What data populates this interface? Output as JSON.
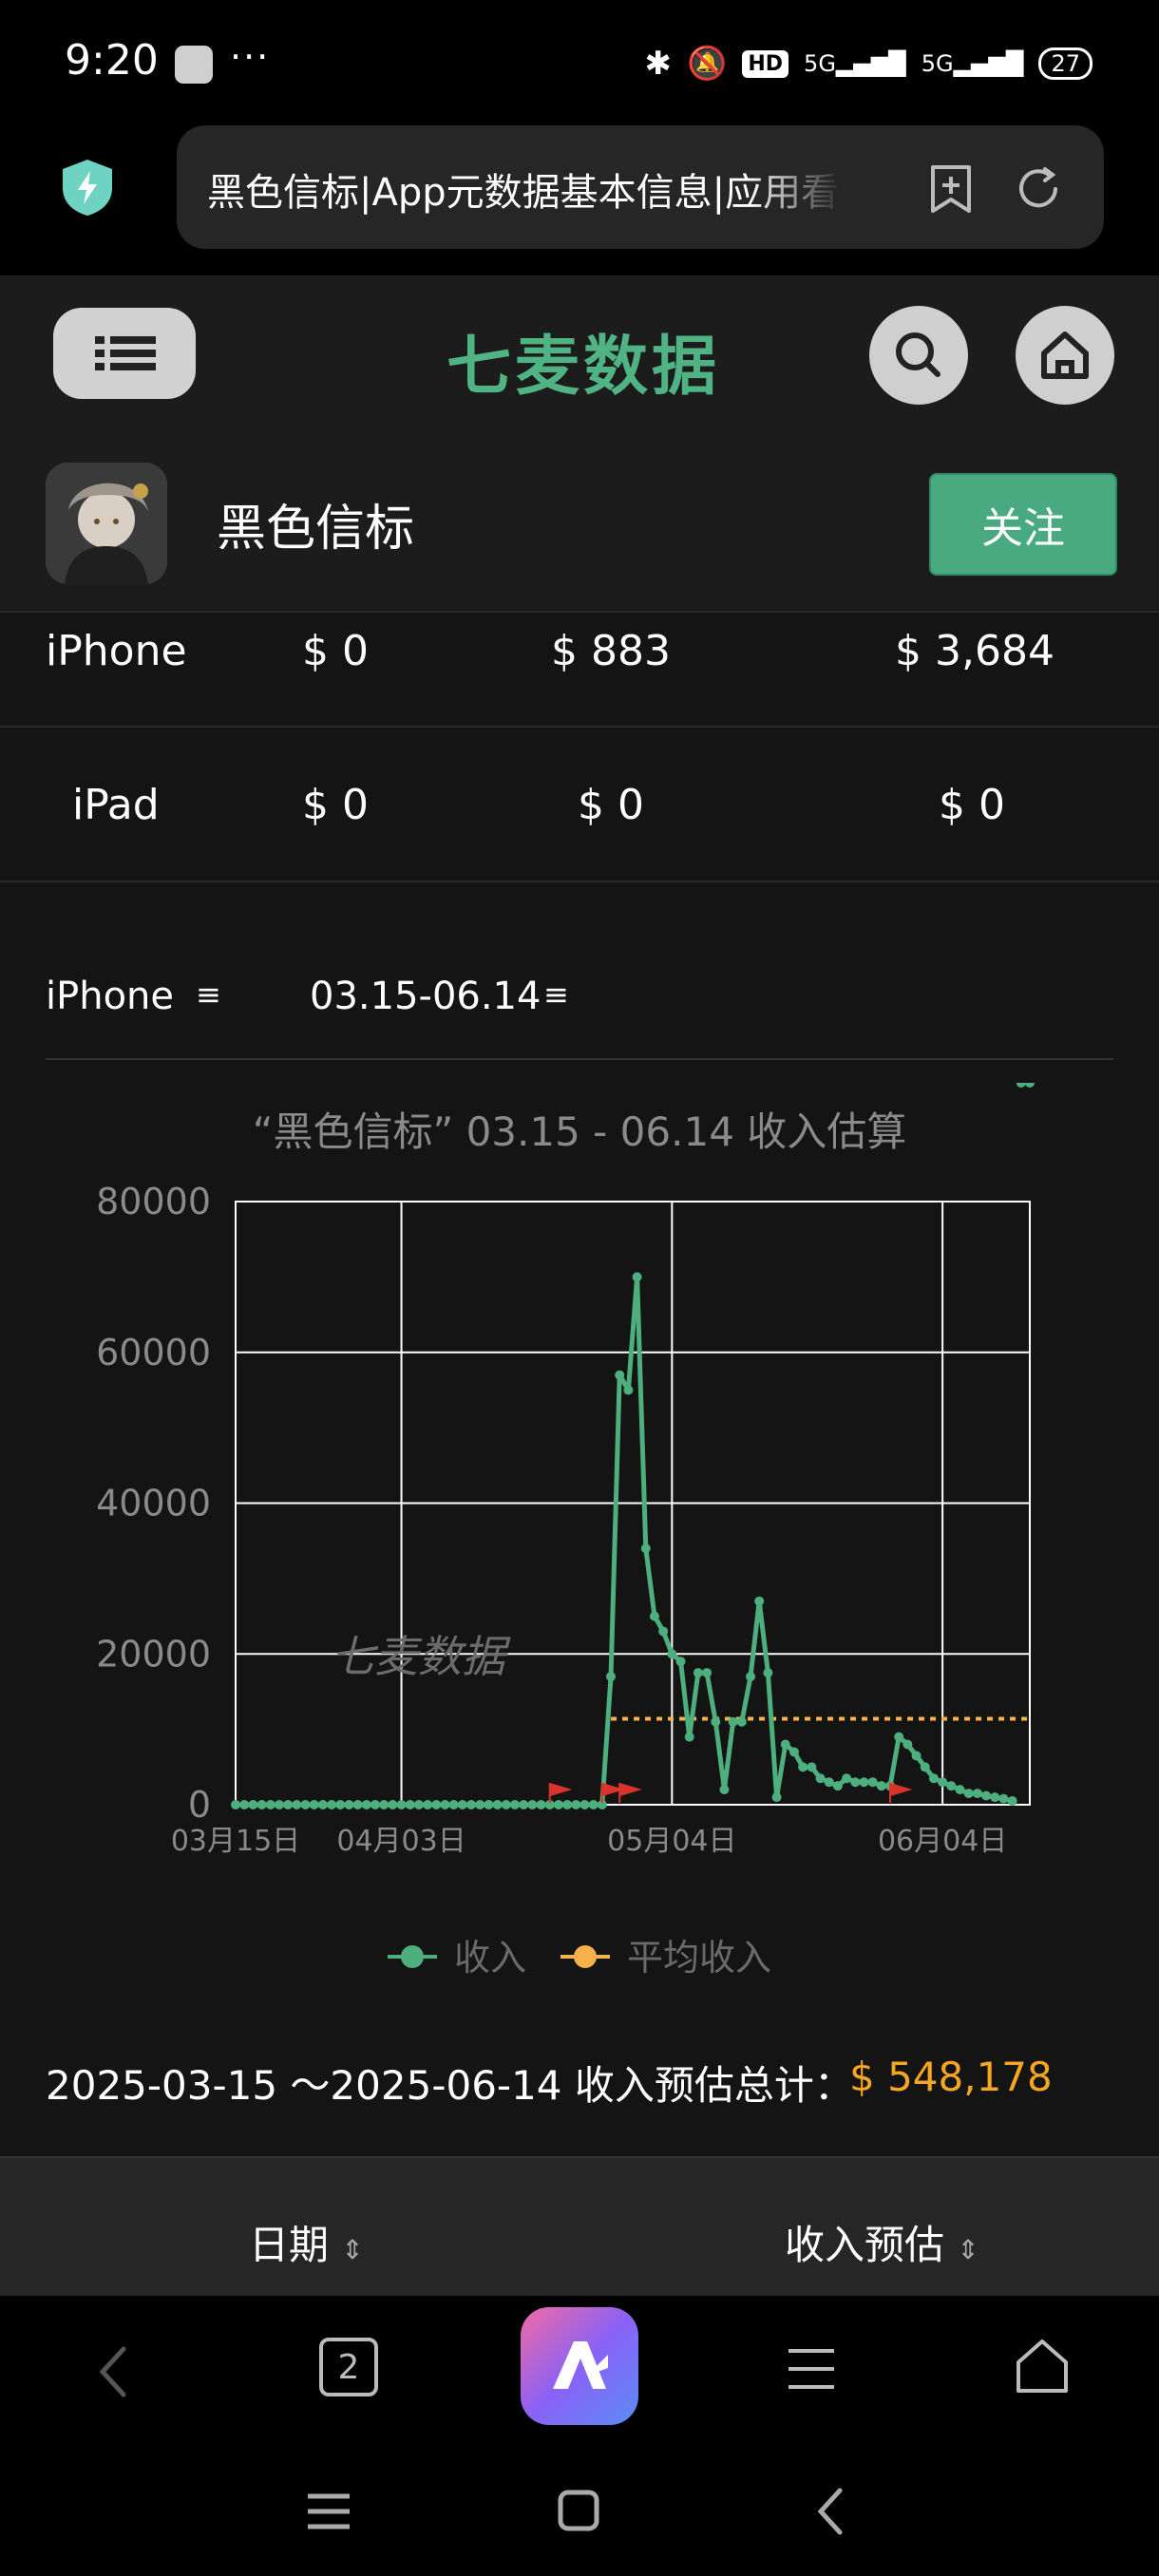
{
  "status_bar": {
    "time": "9:20",
    "more": "···",
    "hd_label": "HD",
    "net1": "5G",
    "net2": "5G",
    "battery": "27"
  },
  "browser": {
    "url_text": "黑色信标|App元数据基本信息|应用看",
    "tab_count": "2"
  },
  "site": {
    "logo_text": "七麦数据"
  },
  "app": {
    "name": "黑色信标",
    "follow_label": "关注"
  },
  "revenue_table": {
    "rows": [
      {
        "device": "iPhone",
        "c1": "$ 0",
        "c2": "$ 883",
        "c3": "$ 3,684"
      },
      {
        "device": "iPad",
        "c1": "$ 0",
        "c2": "$ 0",
        "c3": "$ 0"
      }
    ]
  },
  "chart_controls": {
    "device": "iPhone",
    "date_range": "03.15-06.14"
  },
  "chart_data": {
    "type": "line",
    "title": "“黑色信标” 03.15 - 06.14 收入估算",
    "watermark": "七麦数据",
    "ylim": [
      0,
      80000
    ],
    "yticks": [
      "0",
      "20000",
      "40000",
      "60000",
      "80000"
    ],
    "xtick_labels": [
      "03月15日",
      "04月03日",
      "05月04日",
      "06月04日"
    ],
    "xtick_days": [
      0,
      19,
      50,
      81
    ],
    "series": [
      {
        "name": "收入",
        "color": "#4caf7d",
        "x_days": [
          0,
          1,
          2,
          3,
          4,
          5,
          6,
          7,
          8,
          9,
          10,
          11,
          12,
          13,
          14,
          15,
          16,
          17,
          18,
          19,
          20,
          21,
          22,
          23,
          24,
          25,
          26,
          27,
          28,
          29,
          30,
          31,
          32,
          33,
          34,
          35,
          36,
          37,
          38,
          39,
          40,
          41,
          42,
          43,
          44,
          45,
          46,
          47,
          48,
          49,
          50,
          51,
          52,
          53,
          54,
          55,
          56,
          57,
          58,
          59,
          60,
          61,
          62,
          63,
          64,
          65,
          66,
          67,
          68,
          69,
          70,
          71,
          72,
          73,
          74,
          75,
          76,
          77,
          78,
          79,
          80,
          81,
          82,
          83,
          84,
          85,
          86,
          87,
          88,
          89,
          90,
          91
        ],
        "values": [
          0,
          0,
          0,
          0,
          0,
          0,
          0,
          0,
          0,
          0,
          0,
          0,
          0,
          0,
          0,
          0,
          0,
          0,
          0,
          0,
          0,
          0,
          0,
          0,
          0,
          0,
          0,
          0,
          0,
          0,
          0,
          0,
          0,
          0,
          0,
          0,
          0,
          0,
          0,
          0,
          0,
          0,
          0,
          17000,
          57000,
          55000,
          70000,
          34000,
          25000,
          23000,
          20000,
          19000,
          9000,
          17500,
          17500,
          11000,
          2000,
          11000,
          11000,
          17000,
          27000,
          17500,
          1000,
          8000,
          7000,
          5000,
          5000,
          3500,
          3000,
          2500,
          3500,
          3000,
          3000,
          3000,
          2500,
          2500,
          9000,
          8000,
          6500,
          5000,
          3500,
          3000,
          2500,
          2000,
          1500,
          1500,
          1200,
          1000,
          800,
          500
        ],
        "marker_flags_days": [
          36,
          42,
          44,
          75
        ]
      },
      {
        "name": "平均收入",
        "color": "#f5b14a",
        "x_start": 43,
        "x_end": 91,
        "value": 11400
      }
    ]
  },
  "summary": {
    "label": "2025-03-15 ～2025-06-14 收入预估总计：",
    "value": "$ 548,178"
  },
  "data_table": {
    "col_date": "日期",
    "col_revenue": "收入预估"
  }
}
